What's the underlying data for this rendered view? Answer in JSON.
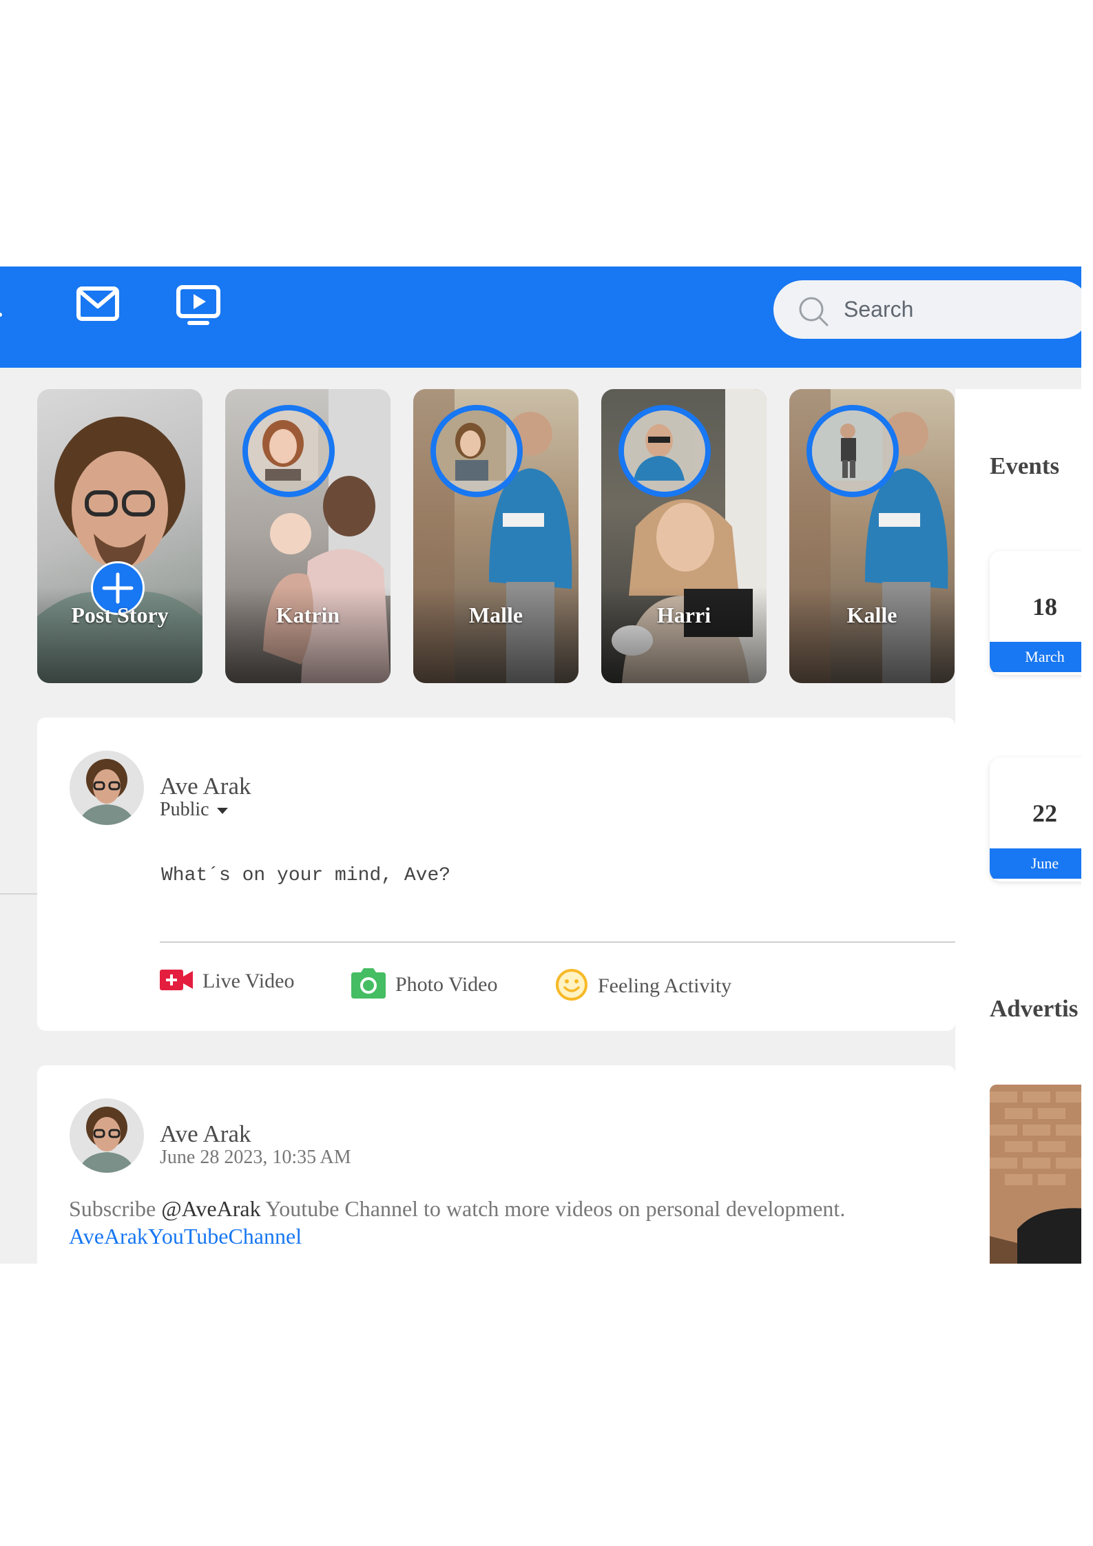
{
  "search": {
    "placeholder": "Search"
  },
  "stories": [
    {
      "name": "Post Story"
    },
    {
      "name": "Katrin"
    },
    {
      "name": "Malle"
    },
    {
      "name": "Harri"
    },
    {
      "name": "Kalle"
    }
  ],
  "composer": {
    "user_name": "Ave Arak",
    "audience": "Public",
    "prompt": "What´s on your mind, Ave?",
    "actions": [
      "Live Video",
      "Photo Video",
      "Feeling Activity"
    ]
  },
  "post": {
    "user_name": "Ave Arak",
    "timestamp": "June 28 2023, 10:35 AM",
    "text_before": "Subscribe ",
    "mention": "@AveArak",
    "text_after": " Youtube Channel to watch more videos on personal development.",
    "link": "AveArakYouTubeChannel"
  },
  "sidebar": {
    "events_title": "Events",
    "events": [
      {
        "day": "18",
        "month": "March"
      },
      {
        "day": "22",
        "month": "June"
      }
    ],
    "ads_title": "Advertis"
  },
  "colors": {
    "accent": "#1877f2",
    "live_red": "#e41e3f",
    "photo_green": "#45bd62",
    "feeling_yellow": "#f7b928"
  }
}
